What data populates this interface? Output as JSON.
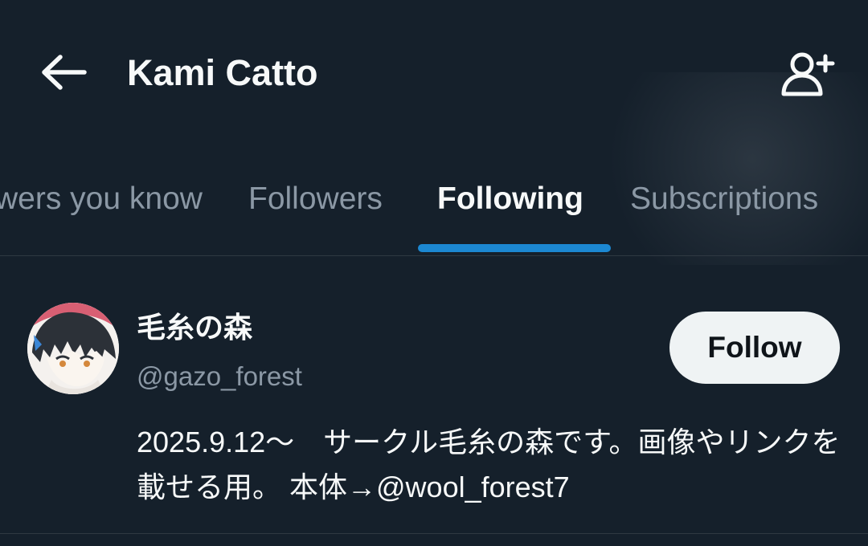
{
  "header": {
    "title": "Kami Catto",
    "back_icon": "arrow-left-icon",
    "add_user_icon": "add-user-icon"
  },
  "tabs": [
    {
      "label": "Followers you know",
      "visible_label": "wers you know",
      "active": false
    },
    {
      "label": "Followers",
      "active": false
    },
    {
      "label": "Following",
      "active": true
    },
    {
      "label": "Subscriptions",
      "active": false
    }
  ],
  "users": [
    {
      "display_name": "毛糸の森",
      "handle": "@gazo_forest",
      "follow_label": "Follow",
      "bio": "2025.9.12〜　サークル毛糸の森です。画像やリンクを載せる用。 本体→@wool_forest7",
      "avatar_icon": "avatar-illustration"
    }
  ],
  "colors": {
    "background": "#15202b",
    "accent": "#1d9bf0",
    "text_primary": "#f7f9f9",
    "text_secondary": "#8b98a5",
    "follow_button_bg": "#eff3f4"
  }
}
